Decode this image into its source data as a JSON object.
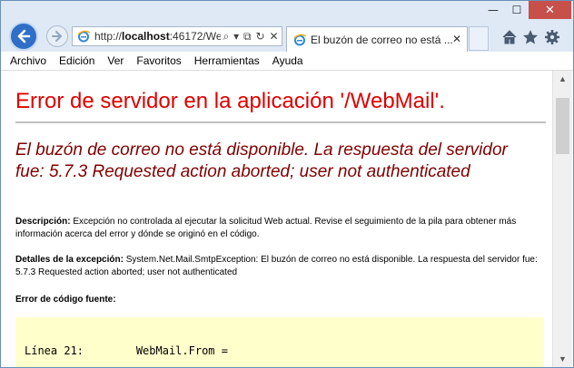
{
  "window": {
    "min_glyph": "—",
    "max_glyph": "☐",
    "close_glyph": "✕"
  },
  "toolbar": {
    "back_icon": "back-arrow-icon",
    "forward_icon": "forward-arrow-icon",
    "url_prefix": "http://",
    "url_host": "localhost",
    "url_rest": ":46172/We",
    "search_glyph": "⌕",
    "dropdown_glyph": "▾",
    "compat_glyph": "⧉",
    "refresh_glyph": "↻",
    "close_glyph": "✕",
    "tab_title": "El buzón de correo no está ...",
    "tab_close": "✕"
  },
  "menu": {
    "items": [
      "Archivo",
      "Edición",
      "Ver",
      "Favoritos",
      "Herramientas",
      "Ayuda"
    ]
  },
  "page": {
    "title": "Error de servidor en la aplicación '/WebMail'.",
    "subtitle": "El buzón de correo no está disponible. La respuesta del servidor fue: 5.7.3 Requested action aborted; user not authenticated",
    "description_label": "Descripción:",
    "description_text": " Excepción no controlada al ejecutar la solicitud Web actual. Revise el seguimiento de la pila para obtener más información acerca del error y dónde se originó en el código.",
    "exception_label": "Detalles de la excepción:",
    "exception_text": " System.Net.Mail.SmtpException: El buzón de correo no está disponible. La respuesta del servidor fue: 5.7.3 Requested action aborted; user not authenticated",
    "source_label": "Error de código fuente:",
    "code_line": "Línea 21:        WebMail.From ="
  },
  "colors": {
    "title": "#e00000",
    "subtitle": "#800000",
    "code_bg": "#ffffcc",
    "accent": "#2f6fc7"
  }
}
